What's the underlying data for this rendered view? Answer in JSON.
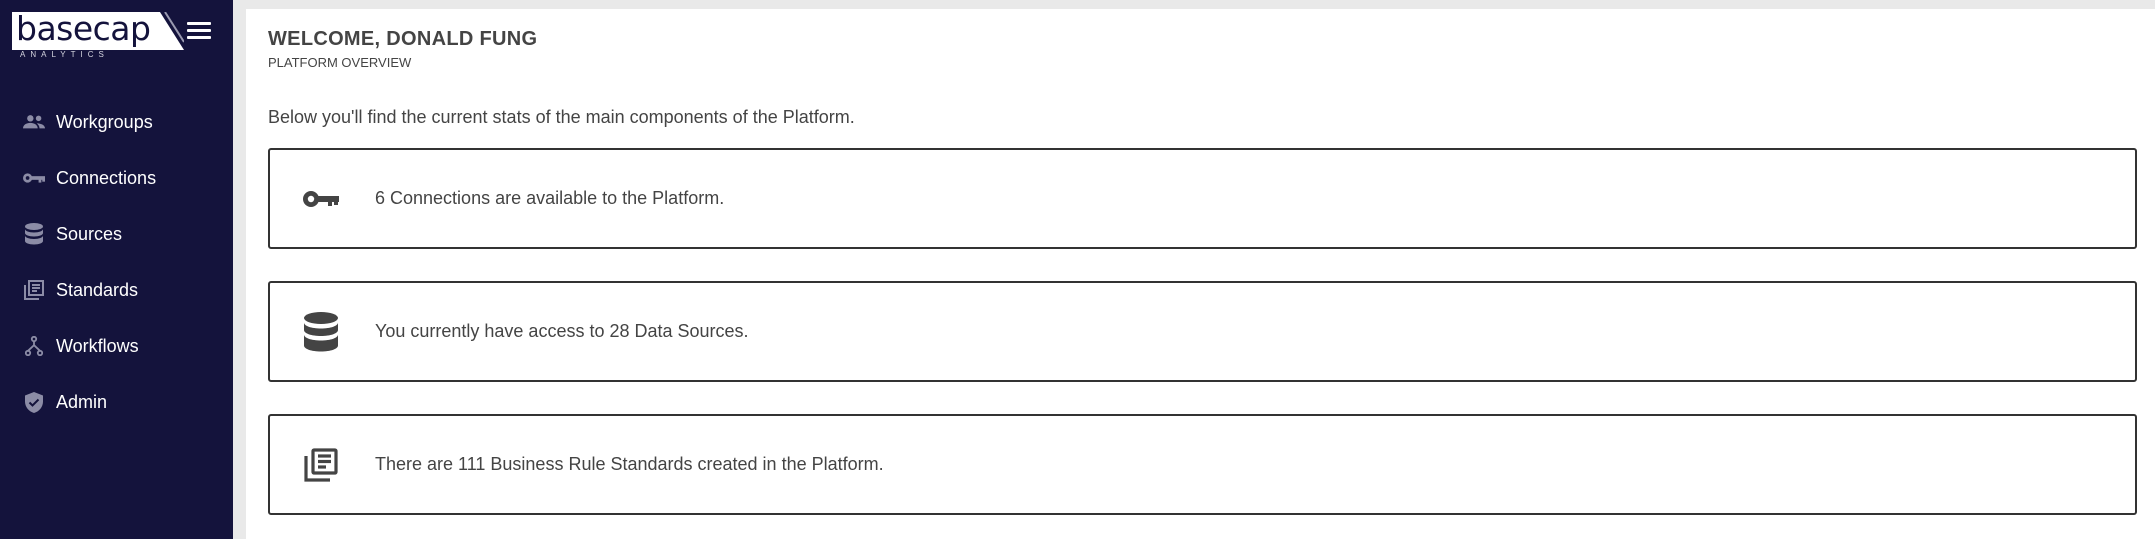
{
  "brand": {
    "name": "basecap",
    "tagline": "ANALYTICS"
  },
  "sidebar": {
    "items": [
      {
        "label": "Workgroups",
        "icon": "people-icon"
      },
      {
        "label": "Connections",
        "icon": "key-icon"
      },
      {
        "label": "Sources",
        "icon": "database-icon"
      },
      {
        "label": "Standards",
        "icon": "library-books-icon"
      },
      {
        "label": "Workflows",
        "icon": "workflow-icon"
      },
      {
        "label": "Admin",
        "icon": "shield-check-icon"
      }
    ]
  },
  "main": {
    "welcome": "WELCOME, DONALD FUNG",
    "subtitle": "PLATFORM OVERVIEW",
    "intro": "Below you'll find the current stats of the main components of the Platform.",
    "cards": [
      {
        "text": "6 Connections are available to the Platform.",
        "icon": "key-icon"
      },
      {
        "text": "You currently have access to 28 Data Sources.",
        "icon": "database-icon"
      },
      {
        "text": "There are 111 Business Rule Standards created in the Platform.",
        "icon": "library-books-icon"
      }
    ]
  },
  "colors": {
    "sidebar_bg": "#14133c",
    "text": "#444444",
    "card_border": "#333333"
  }
}
